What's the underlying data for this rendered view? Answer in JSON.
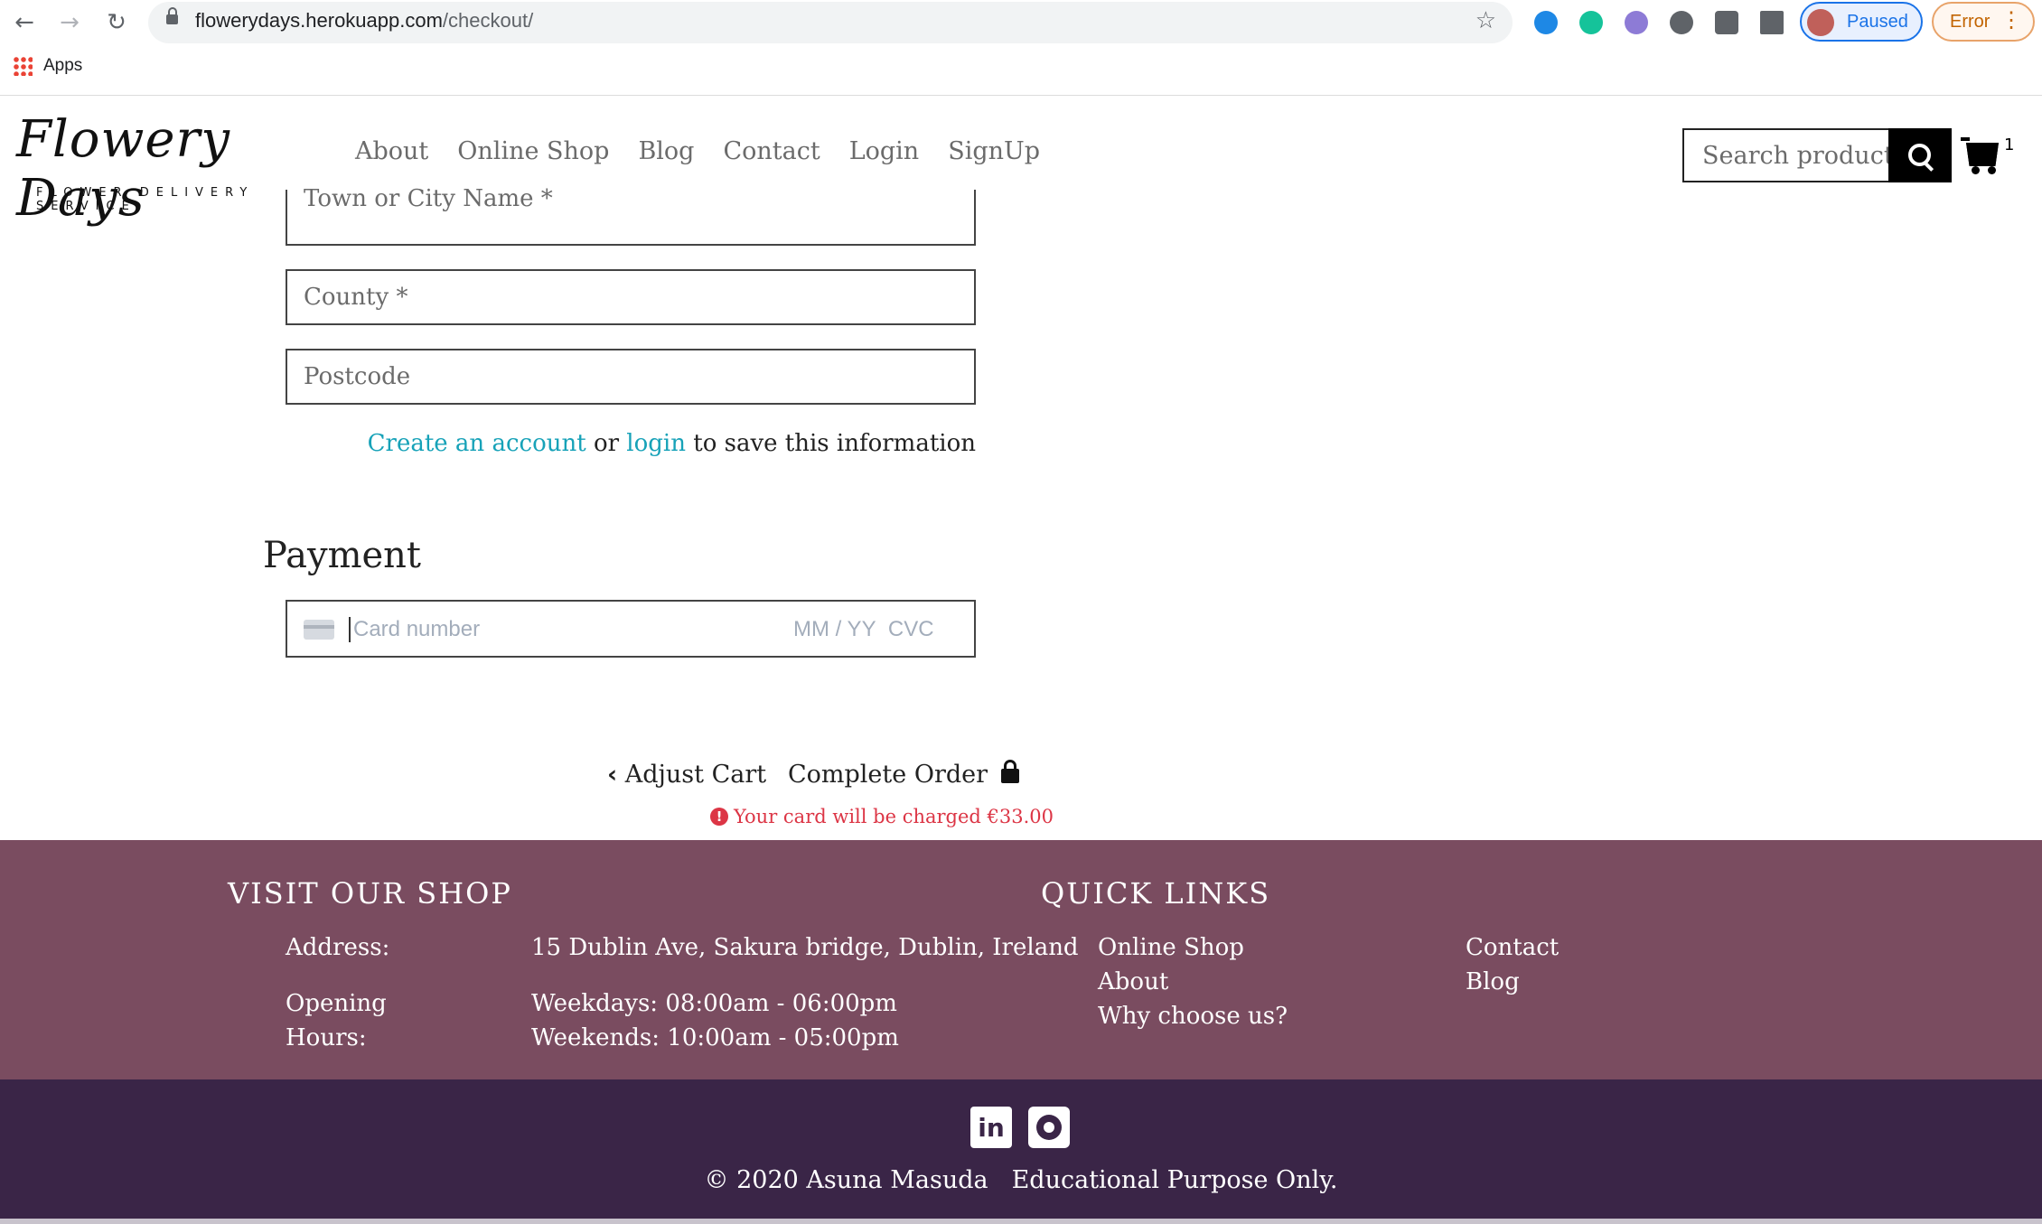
{
  "browser": {
    "url_host": "flowerydays.herokuapp.com",
    "url_path": "/checkout/",
    "bookmarks_apps": "Apps",
    "profile_status": "Paused",
    "error_label": "Error"
  },
  "header": {
    "logo_script": "Flowery Days",
    "logo_tagline": "FLOWER DELIVERY SERVICE",
    "nav": [
      "About",
      "Online Shop",
      "Blog",
      "Contact",
      "Login",
      "SignUp"
    ],
    "search_placeholder": "Search products",
    "cart_count": "1"
  },
  "form": {
    "town_placeholder": "Town or City Name *",
    "county_placeholder": "County *",
    "postcode_placeholder": "Postcode",
    "save_create_link": "Create an account",
    "save_or": "or",
    "save_login_link": "login",
    "save_suffix": "to save this information"
  },
  "payment": {
    "heading": "Payment",
    "card_placeholder": "Card number",
    "expiry_placeholder": "MM / YY",
    "cvc_placeholder": "CVC",
    "adjust_cart": "Adjust Cart",
    "complete_order": "Complete Order",
    "charge_notice": "Your card will be charged €33.00"
  },
  "footer": {
    "visit_heading": "VISIT OUR SHOP",
    "address_label": "Address:",
    "address_value": "15 Dublin Ave, Sakura bridge, Dublin, Ireland",
    "hours_label_1": "Opening",
    "hours_label_2": "Hours:",
    "hours_weekdays": "Weekdays: 08:00am - 06:00pm",
    "hours_weekends": "Weekends: 10:00am - 05:00pm",
    "links_heading": "QUICK LINKS",
    "links_col1": [
      "Online Shop",
      "About",
      "Why choose us?"
    ],
    "links_col2": [
      "Contact",
      "Blog"
    ],
    "copyright": "© 2020 Asuna Masuda",
    "disclaimer": "Educational Purpose Only."
  },
  "colors": {
    "accent_link": "#17a2b8",
    "footer_top": "#7a4c60",
    "footer_bottom": "#3a2547",
    "error": "#dc3545"
  }
}
